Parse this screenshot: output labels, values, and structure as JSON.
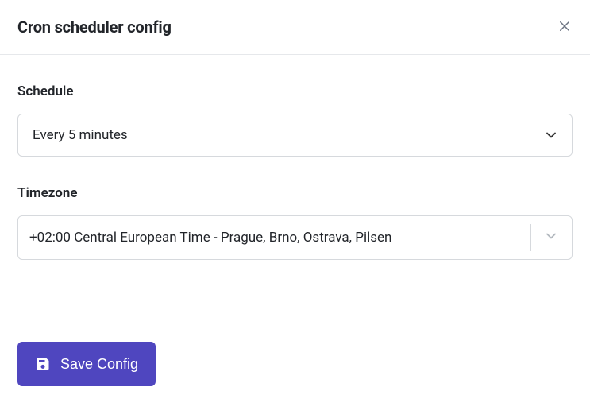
{
  "dialog": {
    "title": "Cron scheduler config"
  },
  "schedule": {
    "label": "Schedule",
    "value": "Every 5 minutes"
  },
  "timezone": {
    "label": "Timezone",
    "value": "+02:00 Central European Time - Prague, Brno, Ostrava, Pilsen"
  },
  "actions": {
    "save_label": "Save Config"
  },
  "colors": {
    "primary": "#4f46bf",
    "border": "#d6d9dd",
    "text": "#22252a"
  }
}
